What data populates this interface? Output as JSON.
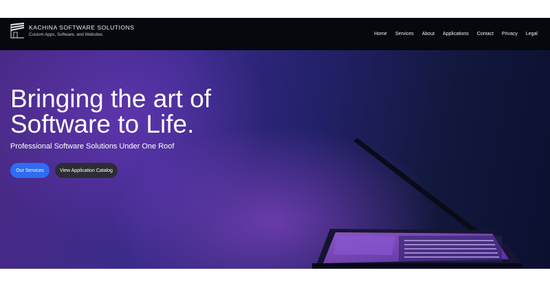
{
  "brand": {
    "name": "KACHINA SOFTWARE SOLUTIONS",
    "tagline": "Custom Apps, Software, and Websites",
    "logo_icon": "kachina-logo-icon"
  },
  "nav": {
    "items": [
      {
        "label": "Home"
      },
      {
        "label": "Services"
      },
      {
        "label": "About"
      },
      {
        "label": "Applications"
      },
      {
        "label": "Contact"
      },
      {
        "label": "Privacy"
      },
      {
        "label": "Legal"
      }
    ]
  },
  "hero": {
    "title_line1": "Bringing the art of",
    "title_line2": "Software to Life.",
    "subtitle": "Professional Software Solutions Under One Roof",
    "primary_button": "Our Services",
    "secondary_button": "View Application Catalog",
    "image": "laptop-in-purple-light-image"
  },
  "colors": {
    "nav_background": "#05080d",
    "primary_button": "#2f6cf3",
    "secondary_button": "#2c2d33",
    "hero_purple": "#4a2a86",
    "hero_navy": "#0b1030"
  }
}
